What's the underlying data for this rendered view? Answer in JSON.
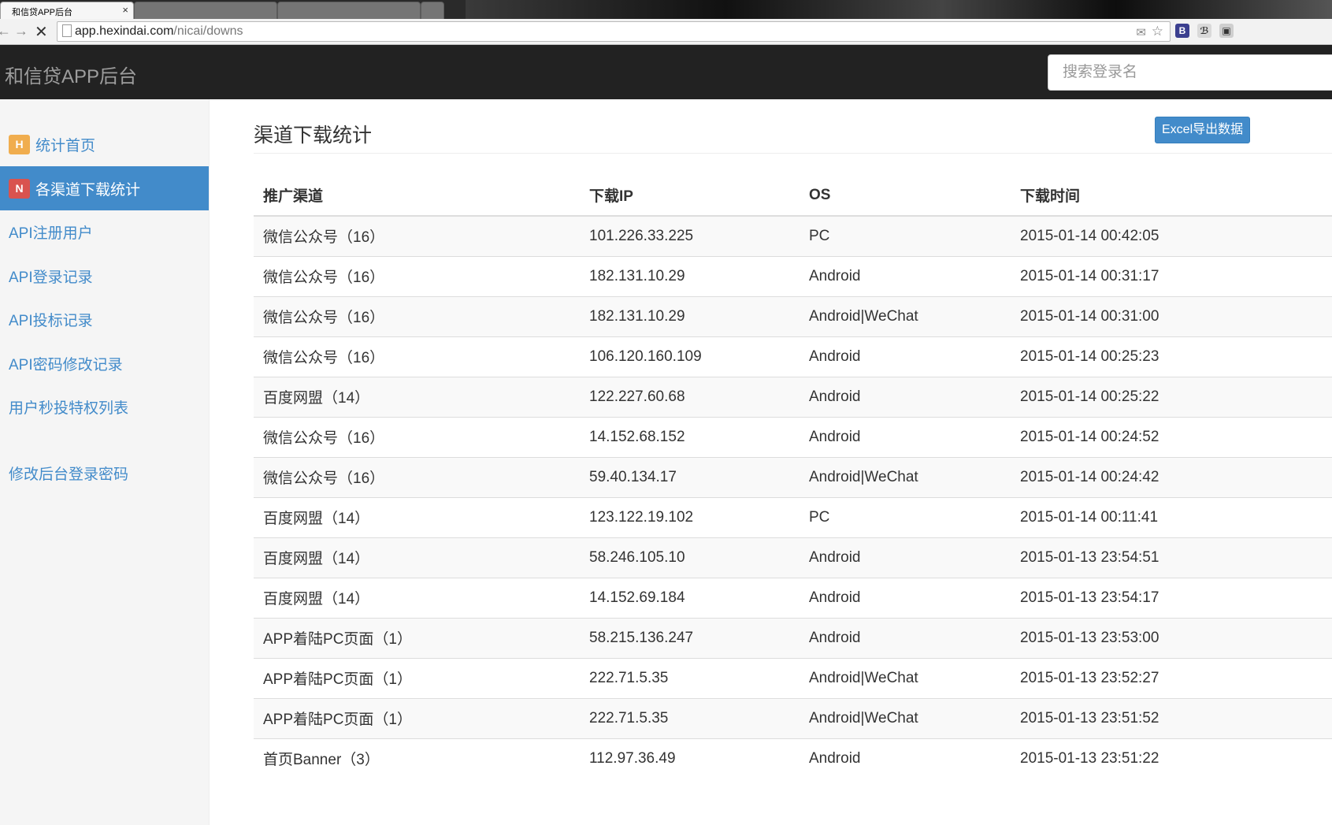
{
  "browser": {
    "active_tab_title": "和信贷APP后台",
    "tab_close": "×",
    "url_host": "app.hexindai.com",
    "url_path": "/nicai/downs",
    "back_glyph": "←",
    "forward_glyph": "→",
    "stop_glyph": "✕",
    "star_glyph": "☆",
    "mail_glyph": "✉",
    "extensions": [
      "B",
      "ℬ",
      "▣"
    ]
  },
  "navbar": {
    "brand": "和信贷APP后台",
    "search_placeholder": "搜索登录名"
  },
  "sidebar": {
    "items": [
      {
        "badge": "H",
        "label": "统计首页"
      },
      {
        "badge": "N",
        "label": "各渠道下载统计"
      },
      {
        "label": "API注册用户"
      },
      {
        "label": "API登录记录"
      },
      {
        "label": "API投标记录"
      },
      {
        "label": "API密码修改记录"
      },
      {
        "label": "用户秒投特权列表"
      },
      {
        "label": "修改后台登录密码"
      }
    ]
  },
  "main": {
    "title": "渠道下载统计",
    "export_button": "Excel导出数据",
    "table": {
      "headers": [
        "推广渠道",
        "下载IP",
        "OS",
        "下载时间"
      ],
      "rows": [
        [
          "微信公众号（16）",
          "101.226.33.225",
          "PC",
          "2015-01-14 00:42:05"
        ],
        [
          "微信公众号（16）",
          "182.131.10.29",
          "Android",
          "2015-01-14 00:31:17"
        ],
        [
          "微信公众号（16）",
          "182.131.10.29",
          "Android|WeChat",
          "2015-01-14 00:31:00"
        ],
        [
          "微信公众号（16）",
          "106.120.160.109",
          "Android",
          "2015-01-14 00:25:23"
        ],
        [
          "百度网盟（14）",
          "122.227.60.68",
          "Android",
          "2015-01-14 00:25:22"
        ],
        [
          "微信公众号（16）",
          "14.152.68.152",
          "Android",
          "2015-01-14 00:24:52"
        ],
        [
          "微信公众号（16）",
          "59.40.134.17",
          "Android|WeChat",
          "2015-01-14 00:24:42"
        ],
        [
          "百度网盟（14）",
          "123.122.19.102",
          "PC",
          "2015-01-14 00:11:41"
        ],
        [
          "百度网盟（14）",
          "58.246.105.10",
          "Android",
          "2015-01-13 23:54:51"
        ],
        [
          "百度网盟（14）",
          "14.152.69.184",
          "Android",
          "2015-01-13 23:54:17"
        ],
        [
          "APP着陆PC页面（1）",
          "58.215.136.247",
          "Android",
          "2015-01-13 23:53:00"
        ],
        [
          "APP着陆PC页面（1）",
          "222.71.5.35",
          "Android|WeChat",
          "2015-01-13 23:52:27"
        ],
        [
          "APP着陆PC页面（1）",
          "222.71.5.35",
          "Android|WeChat",
          "2015-01-13 23:51:52"
        ],
        [
          "首页Banner（3）",
          "112.97.36.49",
          "Android",
          "2015-01-13 23:51:22"
        ]
      ]
    }
  }
}
